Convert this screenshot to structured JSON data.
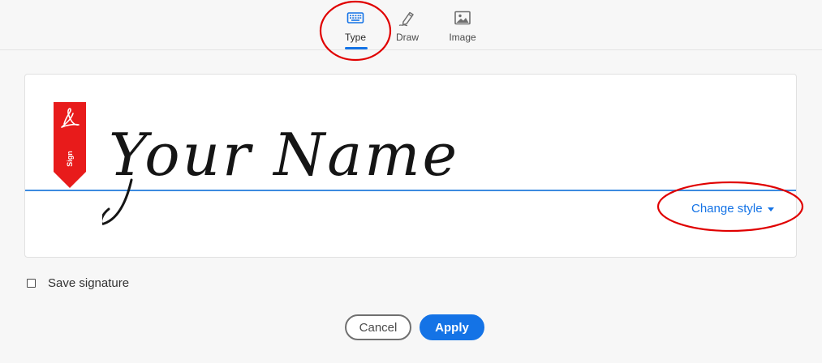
{
  "tabs": [
    {
      "label": "Type",
      "icon": "keyboard-icon",
      "active": true
    },
    {
      "label": "Draw",
      "icon": "pen-icon",
      "active": false
    },
    {
      "label": "Image",
      "icon": "image-icon",
      "active": false
    }
  ],
  "signature": {
    "text": "Your Name",
    "tag_label": "Sign",
    "change_style_label": "Change style"
  },
  "save_signature": {
    "label": "Save signature",
    "checked": false
  },
  "buttons": {
    "cancel_label": "Cancel",
    "apply_label": "Apply"
  },
  "colors": {
    "accent": "#1473e6",
    "tag_red": "#e81b1b",
    "annotation_red": "#e00000"
  }
}
